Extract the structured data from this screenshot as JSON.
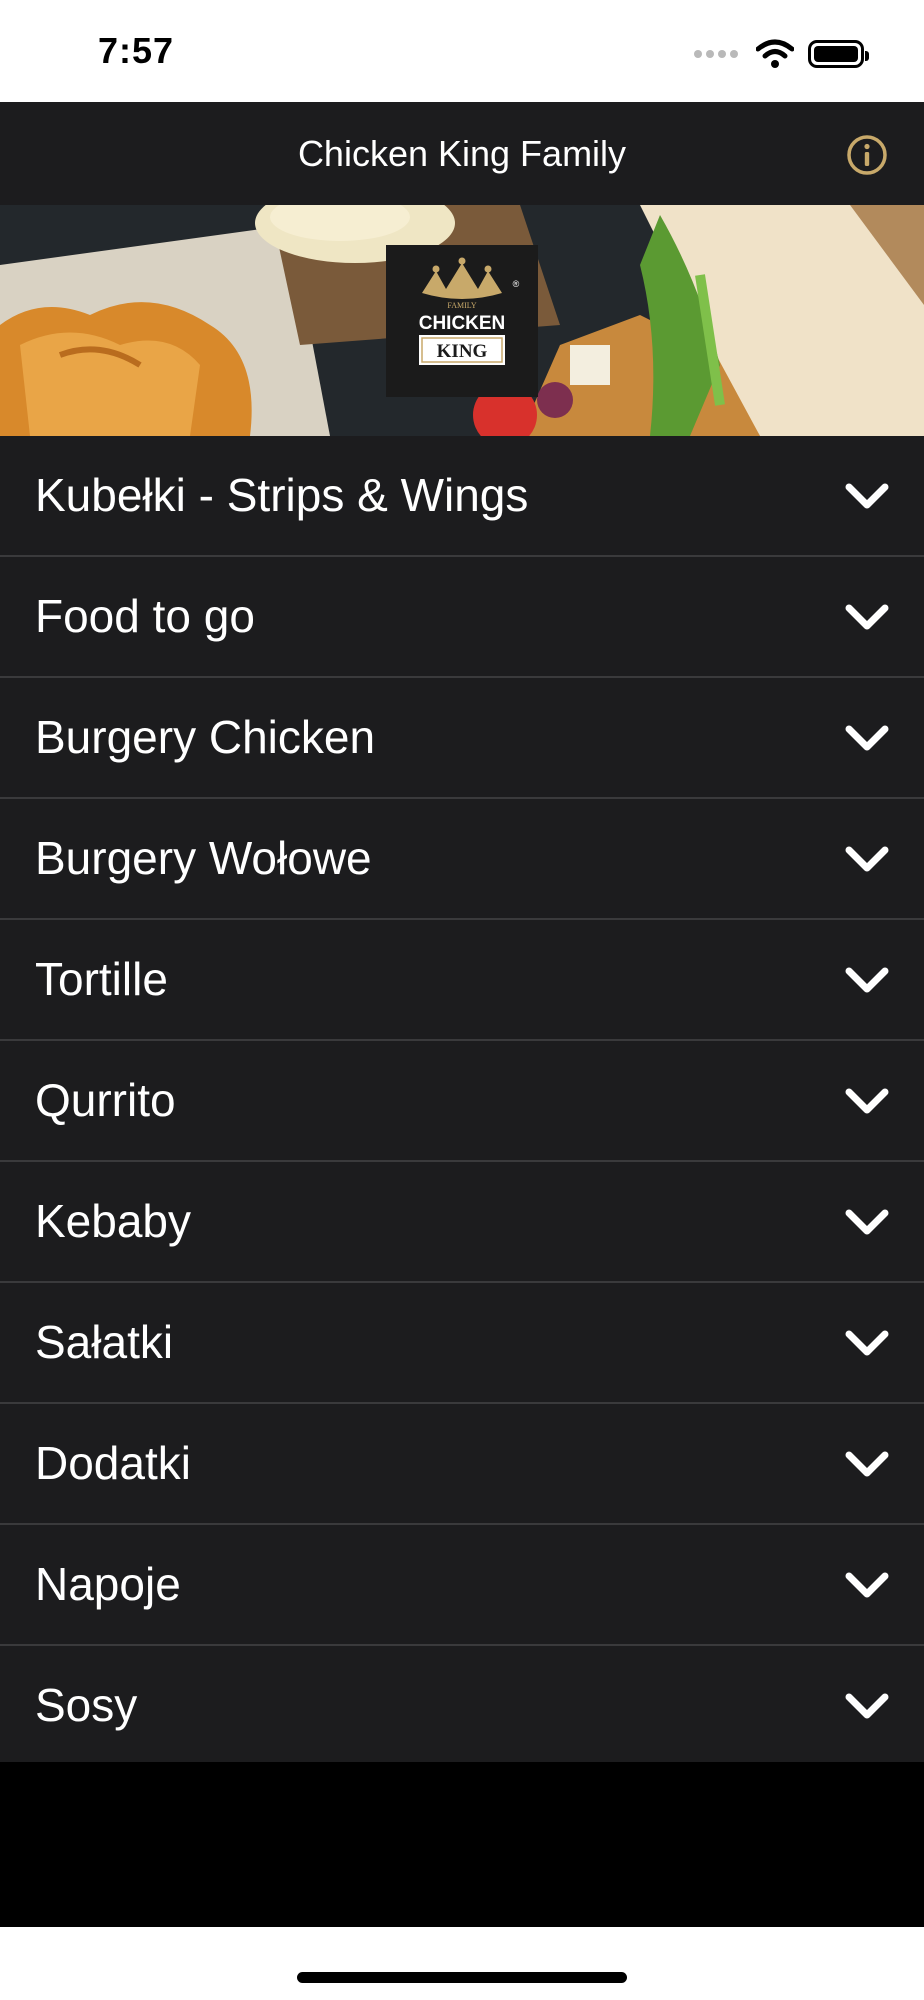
{
  "status_bar": {
    "time": "7:57"
  },
  "nav": {
    "title": "Chicken King Family",
    "info_icon": "info-circle-icon",
    "accent": "#c8a96a"
  },
  "logo": {
    "top_text": "FAMILY",
    "line1": "CHICKEN",
    "line2": "KING",
    "registered": "®"
  },
  "menu": [
    {
      "label": "Kubełki - Strips & Wings"
    },
    {
      "label": "Food to go"
    },
    {
      "label": "Burgery Chicken"
    },
    {
      "label": "Burgery Wołowe"
    },
    {
      "label": "Tortille"
    },
    {
      "label": "Qurrito"
    },
    {
      "label": "Kebaby"
    },
    {
      "label": "Sałatki"
    },
    {
      "label": "Dodatki"
    },
    {
      "label": "Napoje"
    },
    {
      "label": "Sosy"
    }
  ],
  "colors": {
    "bar": "#1c1c1e",
    "separator": "#3a3a3c",
    "text": "#ffffff"
  }
}
